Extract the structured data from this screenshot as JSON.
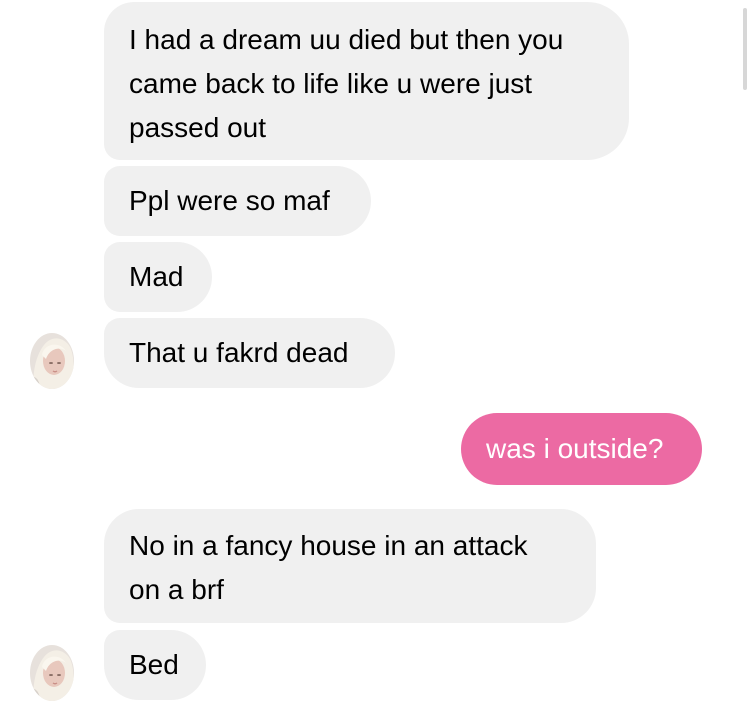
{
  "messages": [
    {
      "id": "m1",
      "side": "received",
      "lines": [
        "I had a dream uu died but then you",
        "came back to life like u were just",
        "passed out"
      ]
    },
    {
      "id": "m2",
      "side": "received",
      "lines": [
        "Ppl were so maf"
      ]
    },
    {
      "id": "m3",
      "side": "received",
      "lines": [
        "Mad"
      ]
    },
    {
      "id": "m4",
      "side": "received",
      "lines": [
        "That u fakrd dead"
      ]
    },
    {
      "id": "m5",
      "side": "sent",
      "lines": [
        "was i outside?"
      ]
    },
    {
      "id": "m6",
      "side": "received",
      "lines": [
        "No in a fancy house in an attack",
        "on a brf"
      ]
    },
    {
      "id": "m7",
      "side": "received",
      "lines": [
        "Bed"
      ]
    }
  ],
  "colors": {
    "received_bubble": "#f0f0f0",
    "sent_bubble": "#ec6aa3",
    "sent_text": "#ffffff",
    "received_text": "#000000"
  },
  "avatar": {
    "icon": "contact-avatar-photo"
  }
}
